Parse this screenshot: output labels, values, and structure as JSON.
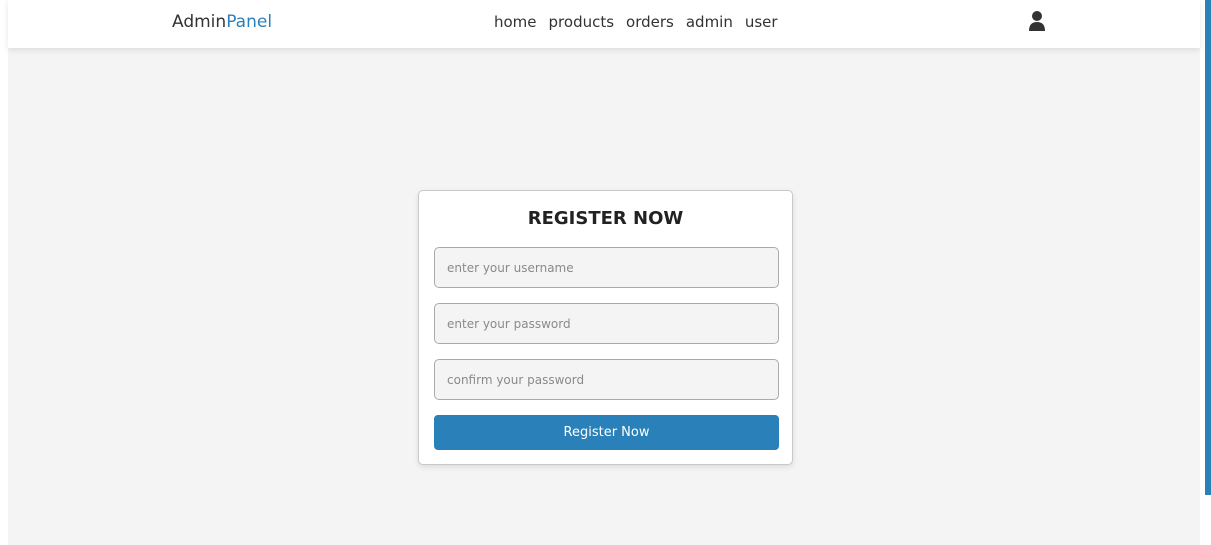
{
  "header": {
    "logo_prefix": "Admin",
    "logo_accent": "Panel",
    "nav": {
      "home": "home",
      "products": "products",
      "orders": "orders",
      "admin": "admin",
      "user": "user"
    },
    "user_icon": "user-icon"
  },
  "form": {
    "title": "REGISTER NOW",
    "username_placeholder": "enter your username",
    "username_value": "",
    "password_placeholder": "enter your password",
    "password_value": "",
    "confirm_placeholder": "confirm your password",
    "confirm_value": "",
    "submit_label": "Register Now"
  },
  "colors": {
    "accent": "#2a80b9",
    "background": "#f4f4f4",
    "text": "#333333"
  }
}
